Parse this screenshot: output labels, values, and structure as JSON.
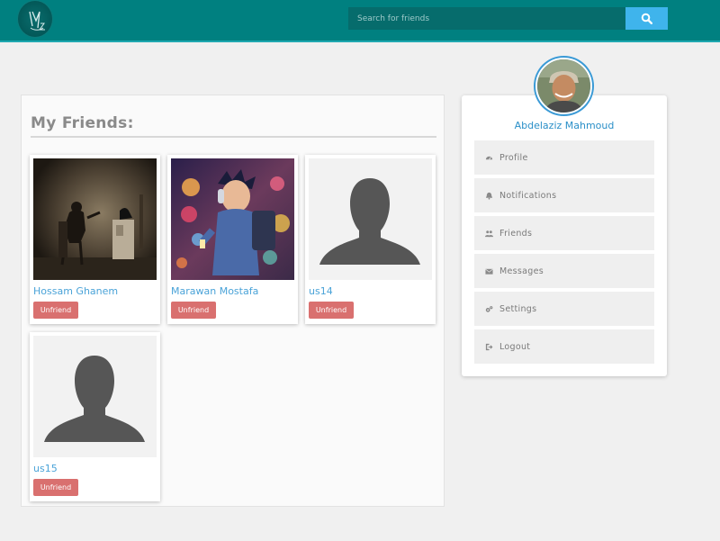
{
  "header": {
    "search": {
      "placeholder": "Search for friends"
    }
  },
  "friends_panel": {
    "title": "My Friends:",
    "unfriend_label": "Unfriend",
    "friends": [
      {
        "name": "Hossam Ghanem",
        "photo": "raven-scene-photo"
      },
      {
        "name": "Marawan Mostafa",
        "photo": "anime-headphones-photo"
      },
      {
        "name": "us14",
        "photo": "default-avatar-silhouette"
      },
      {
        "name": "us15",
        "photo": "default-avatar-silhouette"
      }
    ]
  },
  "profile": {
    "name": "Abdelaziz Mahmoud",
    "menu": [
      {
        "label": "Profile",
        "icon": "dashboard-icon"
      },
      {
        "label": "Notifications",
        "icon": "bell-icon"
      },
      {
        "label": "Friends",
        "icon": "users-icon"
      },
      {
        "label": "Messages",
        "icon": "envelope-icon"
      },
      {
        "label": "Settings",
        "icon": "cogs-icon"
      },
      {
        "label": "Logout",
        "icon": "sign-out-icon"
      }
    ]
  },
  "colors": {
    "header": "#008080",
    "search_button": "#3fb4ec",
    "unfriend": "#d9706f",
    "link": "#4aa3d8"
  }
}
